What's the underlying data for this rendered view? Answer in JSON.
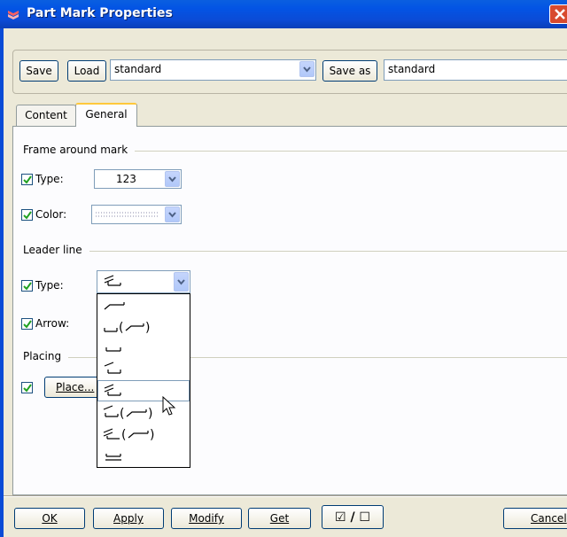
{
  "window": {
    "title": "Part Mark Properties"
  },
  "toolbar": {
    "save_label": "Save",
    "load_label": "Load",
    "preset_value": "standard",
    "save_as_label": "Save as",
    "save_as_value": "standard"
  },
  "tabs": [
    {
      "label": "Content"
    },
    {
      "label": "General"
    }
  ],
  "frame_section": {
    "title": "Frame around mark",
    "type_label": "Type:",
    "type_value": "123",
    "color_label": "Color:"
  },
  "leader_section": {
    "title": "Leader line",
    "type_label": "Type:",
    "arrow_label": "Arrow:"
  },
  "placing_section": {
    "title": "Placing",
    "place_button": "Place..."
  },
  "leader_options": [
    {
      "icon": "leader-straight-icon"
    },
    {
      "icon": "leader-box-paren-icon"
    },
    {
      "icon": "leader-box-icon"
    },
    {
      "icon": "leader-slant-box-icon"
    },
    {
      "icon": "leader-double-slant-icon"
    },
    {
      "icon": "leader-slant-paren-icon"
    },
    {
      "icon": "leader-double-paren-icon"
    },
    {
      "icon": "leader-underline-icon"
    }
  ],
  "footer": {
    "ok_label": "OK",
    "apply_label": "Apply",
    "modify_label": "Modify",
    "get_label": "Get",
    "toggle_label": "☑ / ☐",
    "cancel_label": "Cancel"
  },
  "colors": {
    "titlebar": "#0a5fe0",
    "dialog_bg": "#ece9d8",
    "active_tab_accent": "#ffc83c",
    "checkbox_check": "#21a121"
  }
}
